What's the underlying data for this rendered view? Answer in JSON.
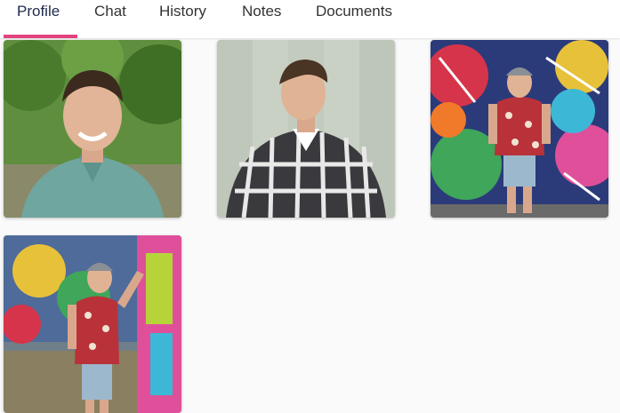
{
  "tabs": [
    {
      "label": "Profile",
      "active": true
    },
    {
      "label": "Chat",
      "active": false
    },
    {
      "label": "History",
      "active": false
    },
    {
      "label": "Notes",
      "active": false
    },
    {
      "label": "Documents",
      "active": false
    }
  ],
  "colors": {
    "accent": "#e2437f",
    "tab_text": "#333333",
    "active_tab_text": "#1f2b4d",
    "background": "#fafafa"
  },
  "photos": [
    {
      "subject": "man-smiling-green-henley-trees"
    },
    {
      "subject": "man-plaid-shirt-gray-wall"
    },
    {
      "subject": "man-floral-shirt-graffiti-wall"
    },
    {
      "subject": "man-leaning-graffiti-wall"
    }
  ]
}
